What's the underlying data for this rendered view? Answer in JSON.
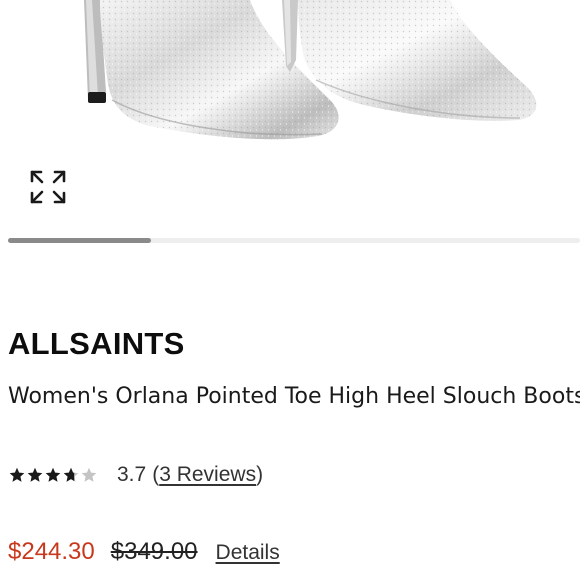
{
  "product_image": {
    "alt_icon": "expand-icon"
  },
  "carousel": {
    "progress": 0.25
  },
  "product": {
    "brand": "ALLSAINTS",
    "name": "Women's Orlana Pointed Toe High Heel Slouch Boots",
    "rating": {
      "stars_filled": 3.7,
      "stars_total": 5,
      "value": "3.7",
      "reviews_open": "(",
      "reviews_label": "3 Reviews",
      "reviews_close": ")"
    },
    "price": {
      "sale": "$244.30",
      "original": "$349.00",
      "details_label": "Details"
    }
  },
  "colors": {
    "sale_price": "#c8381c",
    "star_filled": "#1a1a1a",
    "star_empty": "#c4c4c4",
    "carousel_fill": "#8a8a8a",
    "carousel_track": "#eeeeee"
  }
}
